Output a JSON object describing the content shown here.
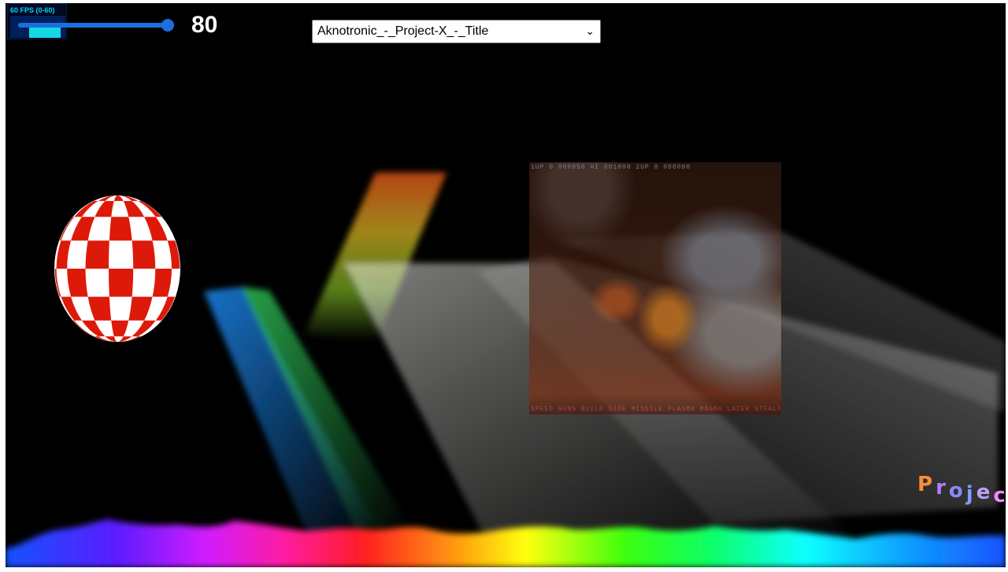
{
  "fps_meter": {
    "label": "60 FPS (0-60)",
    "fps": 60,
    "range": [
      0,
      60
    ]
  },
  "speed": {
    "value": "80",
    "fraction": 1.0,
    "track_color": "#1a6fe0"
  },
  "tune_selector": {
    "selected": "Aknotronic_-_Project-X_-_Title",
    "icon": "chevron-down-icon"
  },
  "game_view": {
    "hud_top": "1UP 0 000050  HI 001000  2UP 0 000000",
    "hud_bottom": "SPEED GUNS BUILD SIDE MISSILE PLASMA MAGMA LAZER STEALTH"
  },
  "ball": {
    "colors": [
      "#dd1a0a",
      "#ffffff"
    ]
  },
  "scroller": {
    "letters": [
      "P",
      "r",
      "o",
      "j",
      "e",
      "c"
    ],
    "colors": [
      "#ff8c3a",
      "#b07cff",
      "#8f86ff",
      "#7f9dff",
      "#b9a0ff",
      "#f08aff"
    ]
  }
}
